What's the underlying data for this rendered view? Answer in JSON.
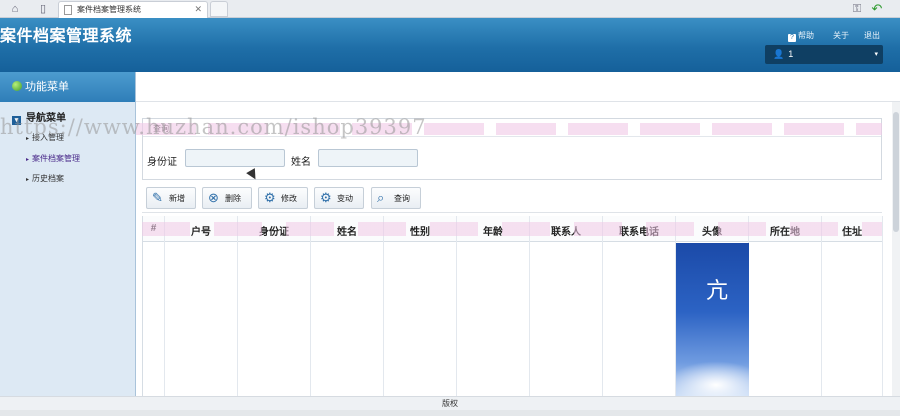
{
  "browser": {
    "tab_title": "案件档案管理系统"
  },
  "header": {
    "title": "案件档案管理系统",
    "links": {
      "help": "帮助",
      "about": "关于",
      "logout": "退出"
    },
    "user": "1"
  },
  "sidebar": {
    "menu_title": "功能菜单",
    "nav_group": "导航菜单",
    "items": [
      {
        "label": "接入管理"
      },
      {
        "label": "案件档案管理"
      },
      {
        "label": "历史档案"
      }
    ]
  },
  "query": {
    "title": "查询",
    "fields": [
      {
        "label": "身份证",
        "value": ""
      },
      {
        "label": "姓名",
        "value": ""
      }
    ]
  },
  "toolbar": {
    "add": "新增",
    "delete": "删除",
    "edit": "修改",
    "change": "变动",
    "search": "查询"
  },
  "grid": {
    "columns": [
      "#",
      "户号",
      "身份证",
      "姓名",
      "性别",
      "年龄",
      "联系人",
      "联系电话",
      "头像",
      "所在地",
      "住址"
    ]
  },
  "footer": {
    "text": "版权"
  },
  "watermark": "https://www.huzhan.com/ishop39397",
  "colors": {
    "header": "#1f6fa8",
    "sidebar": "#dde9f4",
    "menu_header": "#2f7eb8"
  }
}
